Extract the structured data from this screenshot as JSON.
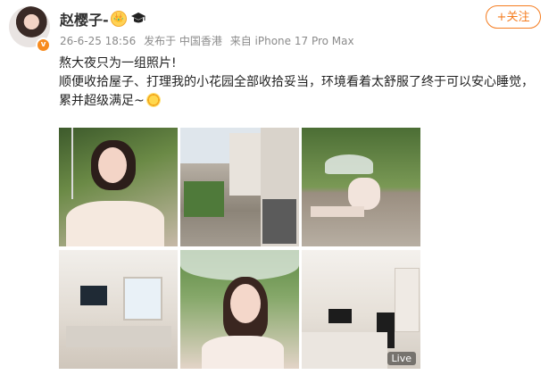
{
  "post": {
    "username": "赵樱子-",
    "level_badge": "👑",
    "timestamp": "26-6-25 18:56",
    "location": "发布于 中国香港",
    "device": "来自 iPhone 17 Pro Max",
    "follow_label": "+关注",
    "text_line1": "熬大夜只为一组照片!",
    "text_line2": "顺便收拾屋子、打理我的小花园全部收拾妥当，环境看着太舒服了终于可以安心睡觉，累并超级满足~",
    "photos": [
      {
        "id": "p1"
      },
      {
        "id": "p2"
      },
      {
        "id": "p3"
      },
      {
        "id": "p4"
      },
      {
        "id": "p5"
      },
      {
        "id": "p6",
        "badge": "Live"
      }
    ]
  },
  "colors": {
    "accent": "#f57c1f",
    "meta": "#8b8b8b"
  },
  "icons": {
    "avatar_badge": "verified-orange-icon",
    "cap": "graduation-cap-icon",
    "emoji": "sun-emoji-icon"
  }
}
